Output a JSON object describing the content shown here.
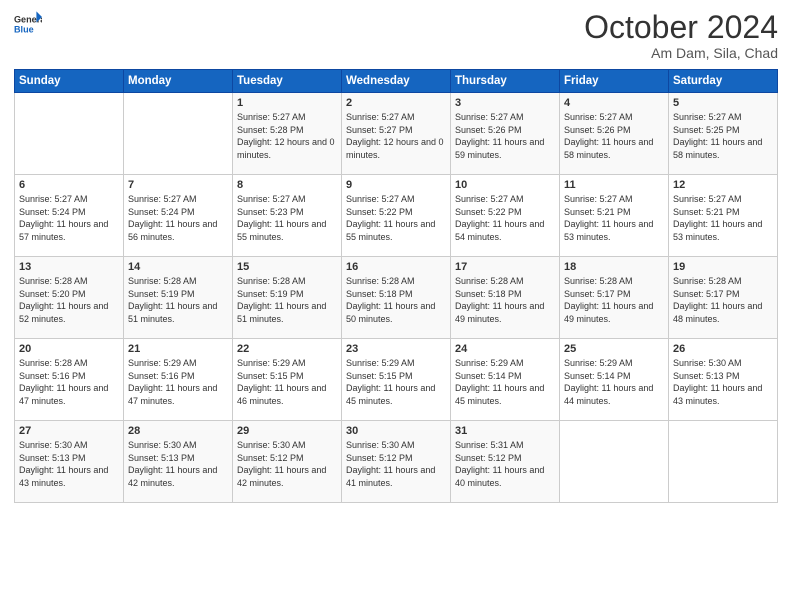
{
  "header": {
    "logo_general": "General",
    "logo_blue": "Blue",
    "month_year": "October 2024",
    "location": "Am Dam, Sila, Chad"
  },
  "days_of_week": [
    "Sunday",
    "Monday",
    "Tuesday",
    "Wednesday",
    "Thursday",
    "Friday",
    "Saturday"
  ],
  "weeks": [
    [
      {
        "day": "",
        "sunrise": "",
        "sunset": "",
        "daylight": ""
      },
      {
        "day": "",
        "sunrise": "",
        "sunset": "",
        "daylight": ""
      },
      {
        "day": "1",
        "sunrise": "Sunrise: 5:27 AM",
        "sunset": "Sunset: 5:28 PM",
        "daylight": "Daylight: 12 hours and 0 minutes."
      },
      {
        "day": "2",
        "sunrise": "Sunrise: 5:27 AM",
        "sunset": "Sunset: 5:27 PM",
        "daylight": "Daylight: 12 hours and 0 minutes."
      },
      {
        "day": "3",
        "sunrise": "Sunrise: 5:27 AM",
        "sunset": "Sunset: 5:26 PM",
        "daylight": "Daylight: 11 hours and 59 minutes."
      },
      {
        "day": "4",
        "sunrise": "Sunrise: 5:27 AM",
        "sunset": "Sunset: 5:26 PM",
        "daylight": "Daylight: 11 hours and 58 minutes."
      },
      {
        "day": "5",
        "sunrise": "Sunrise: 5:27 AM",
        "sunset": "Sunset: 5:25 PM",
        "daylight": "Daylight: 11 hours and 58 minutes."
      }
    ],
    [
      {
        "day": "6",
        "sunrise": "Sunrise: 5:27 AM",
        "sunset": "Sunset: 5:24 PM",
        "daylight": "Daylight: 11 hours and 57 minutes."
      },
      {
        "day": "7",
        "sunrise": "Sunrise: 5:27 AM",
        "sunset": "Sunset: 5:24 PM",
        "daylight": "Daylight: 11 hours and 56 minutes."
      },
      {
        "day": "8",
        "sunrise": "Sunrise: 5:27 AM",
        "sunset": "Sunset: 5:23 PM",
        "daylight": "Daylight: 11 hours and 55 minutes."
      },
      {
        "day": "9",
        "sunrise": "Sunrise: 5:27 AM",
        "sunset": "Sunset: 5:22 PM",
        "daylight": "Daylight: 11 hours and 55 minutes."
      },
      {
        "day": "10",
        "sunrise": "Sunrise: 5:27 AM",
        "sunset": "Sunset: 5:22 PM",
        "daylight": "Daylight: 11 hours and 54 minutes."
      },
      {
        "day": "11",
        "sunrise": "Sunrise: 5:27 AM",
        "sunset": "Sunset: 5:21 PM",
        "daylight": "Daylight: 11 hours and 53 minutes."
      },
      {
        "day": "12",
        "sunrise": "Sunrise: 5:27 AM",
        "sunset": "Sunset: 5:21 PM",
        "daylight": "Daylight: 11 hours and 53 minutes."
      }
    ],
    [
      {
        "day": "13",
        "sunrise": "Sunrise: 5:28 AM",
        "sunset": "Sunset: 5:20 PM",
        "daylight": "Daylight: 11 hours and 52 minutes."
      },
      {
        "day": "14",
        "sunrise": "Sunrise: 5:28 AM",
        "sunset": "Sunset: 5:19 PM",
        "daylight": "Daylight: 11 hours and 51 minutes."
      },
      {
        "day": "15",
        "sunrise": "Sunrise: 5:28 AM",
        "sunset": "Sunset: 5:19 PM",
        "daylight": "Daylight: 11 hours and 51 minutes."
      },
      {
        "day": "16",
        "sunrise": "Sunrise: 5:28 AM",
        "sunset": "Sunset: 5:18 PM",
        "daylight": "Daylight: 11 hours and 50 minutes."
      },
      {
        "day": "17",
        "sunrise": "Sunrise: 5:28 AM",
        "sunset": "Sunset: 5:18 PM",
        "daylight": "Daylight: 11 hours and 49 minutes."
      },
      {
        "day": "18",
        "sunrise": "Sunrise: 5:28 AM",
        "sunset": "Sunset: 5:17 PM",
        "daylight": "Daylight: 11 hours and 49 minutes."
      },
      {
        "day": "19",
        "sunrise": "Sunrise: 5:28 AM",
        "sunset": "Sunset: 5:17 PM",
        "daylight": "Daylight: 11 hours and 48 minutes."
      }
    ],
    [
      {
        "day": "20",
        "sunrise": "Sunrise: 5:28 AM",
        "sunset": "Sunset: 5:16 PM",
        "daylight": "Daylight: 11 hours and 47 minutes."
      },
      {
        "day": "21",
        "sunrise": "Sunrise: 5:29 AM",
        "sunset": "Sunset: 5:16 PM",
        "daylight": "Daylight: 11 hours and 47 minutes."
      },
      {
        "day": "22",
        "sunrise": "Sunrise: 5:29 AM",
        "sunset": "Sunset: 5:15 PM",
        "daylight": "Daylight: 11 hours and 46 minutes."
      },
      {
        "day": "23",
        "sunrise": "Sunrise: 5:29 AM",
        "sunset": "Sunset: 5:15 PM",
        "daylight": "Daylight: 11 hours and 45 minutes."
      },
      {
        "day": "24",
        "sunrise": "Sunrise: 5:29 AM",
        "sunset": "Sunset: 5:14 PM",
        "daylight": "Daylight: 11 hours and 45 minutes."
      },
      {
        "day": "25",
        "sunrise": "Sunrise: 5:29 AM",
        "sunset": "Sunset: 5:14 PM",
        "daylight": "Daylight: 11 hours and 44 minutes."
      },
      {
        "day": "26",
        "sunrise": "Sunrise: 5:30 AM",
        "sunset": "Sunset: 5:13 PM",
        "daylight": "Daylight: 11 hours and 43 minutes."
      }
    ],
    [
      {
        "day": "27",
        "sunrise": "Sunrise: 5:30 AM",
        "sunset": "Sunset: 5:13 PM",
        "daylight": "Daylight: 11 hours and 43 minutes."
      },
      {
        "day": "28",
        "sunrise": "Sunrise: 5:30 AM",
        "sunset": "Sunset: 5:13 PM",
        "daylight": "Daylight: 11 hours and 42 minutes."
      },
      {
        "day": "29",
        "sunrise": "Sunrise: 5:30 AM",
        "sunset": "Sunset: 5:12 PM",
        "daylight": "Daylight: 11 hours and 42 minutes."
      },
      {
        "day": "30",
        "sunrise": "Sunrise: 5:30 AM",
        "sunset": "Sunset: 5:12 PM",
        "daylight": "Daylight: 11 hours and 41 minutes."
      },
      {
        "day": "31",
        "sunrise": "Sunrise: 5:31 AM",
        "sunset": "Sunset: 5:12 PM",
        "daylight": "Daylight: 11 hours and 40 minutes."
      },
      {
        "day": "",
        "sunrise": "",
        "sunset": "",
        "daylight": ""
      },
      {
        "day": "",
        "sunrise": "",
        "sunset": "",
        "daylight": ""
      }
    ]
  ]
}
